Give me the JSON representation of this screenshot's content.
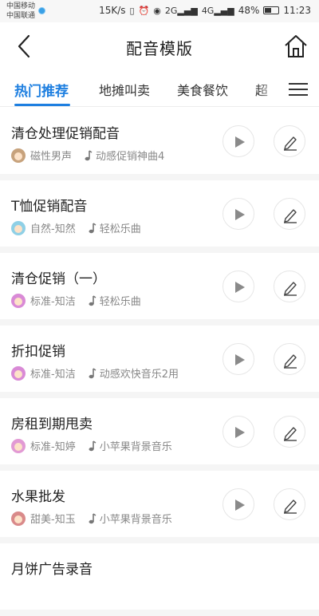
{
  "status_bar": {
    "carrier_1": "中国移动",
    "carrier_2": "中国联通",
    "speed": "15K/s",
    "battery": "48%",
    "time": "11:23",
    "net_1": "2G",
    "net_2": "4G"
  },
  "header": {
    "title": "配音模版",
    "back_icon": "chevron-left-icon",
    "home_icon": "home-icon"
  },
  "tabs": [
    {
      "label": "热门推荐",
      "active": true
    },
    {
      "label": "地摊叫卖",
      "active": false
    },
    {
      "label": "美食餐饮",
      "active": false
    },
    {
      "label": "超",
      "active": false
    }
  ],
  "accent_color": "#1e7fe0",
  "items": [
    {
      "title": "清仓处理促销配音",
      "voice": "磁性男声",
      "music": "动感促销神曲4",
      "avatar_color": "#c7a27c"
    },
    {
      "title": "T恤促销配音",
      "voice": "自然-知然",
      "music": "轻松乐曲",
      "avatar_color": "#8fd0e6"
    },
    {
      "title": "清仓促销（一）",
      "voice": "标准-知洁",
      "music": "轻松乐曲",
      "avatar_color": "#d98ad6"
    },
    {
      "title": "折扣促销",
      "voice": "标准-知洁",
      "music": "动感欢快音乐2用",
      "avatar_color": "#d98ad6"
    },
    {
      "title": "房租到期甩卖",
      "voice": "标准-知婷",
      "music": "小苹果背景音乐",
      "avatar_color": "#e29ad4"
    },
    {
      "title": "水果批发",
      "voice": "甜美-知玉",
      "music": "小苹果背景音乐",
      "avatar_color": "#d98a8a"
    },
    {
      "title": "月饼广告录音",
      "voice": "",
      "music": "",
      "avatar_color": "#d98ad6"
    }
  ]
}
